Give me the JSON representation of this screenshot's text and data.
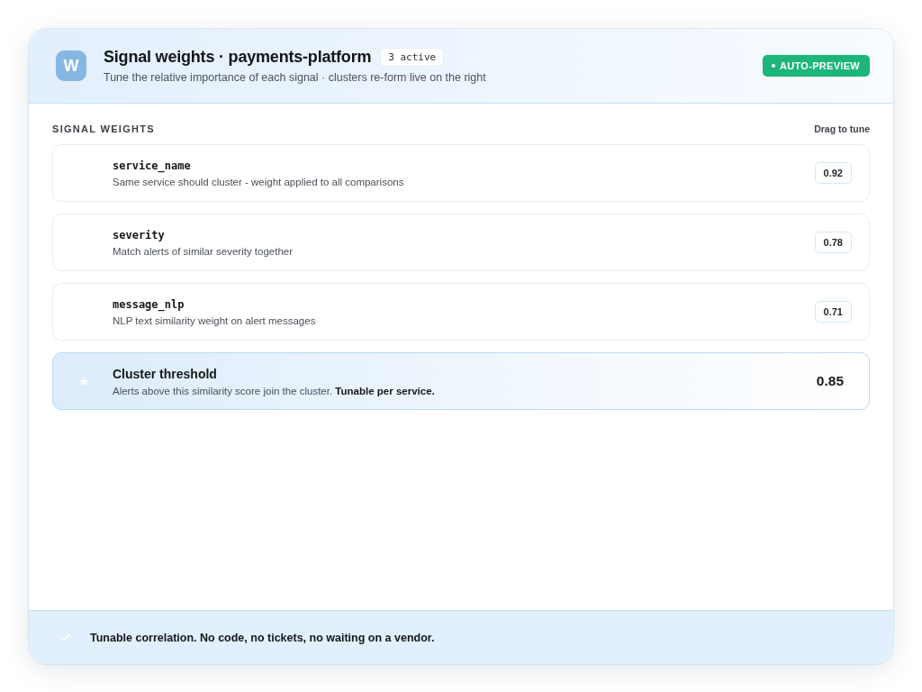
{
  "header": {
    "logo": "W",
    "title": "Signal weights · payments-platform",
    "badge": "3 active",
    "subtitle": "Tune the relative importance of each signal · clusters re-form live on the right",
    "status": {
      "label": "AUTO-PREVIEW"
    }
  },
  "section": {
    "title": "SIGNAL WEIGHTS",
    "hint": "Drag to tune"
  },
  "signals": [
    {
      "kind": "weight",
      "name": "service_name",
      "description": "Same service should cluster - weight applied to all comparisons",
      "value": "0.92"
    },
    {
      "kind": "weight",
      "name": "severity",
      "description": "Match alerts of similar severity together",
      "value": "0.78"
    },
    {
      "kind": "weight",
      "name": "message_nlp",
      "description": "NLP text similarity weight on alert messages",
      "value": "0.71"
    },
    {
      "kind": "threshold",
      "name": "Cluster threshold",
      "description": "Alerts above this similarity score join the cluster. **Tunable per service.**",
      "value": "0.85"
    }
  ],
  "footer": {
    "text": "Tunable correlation. No code, no tickets, no waiting on a vendor."
  }
}
